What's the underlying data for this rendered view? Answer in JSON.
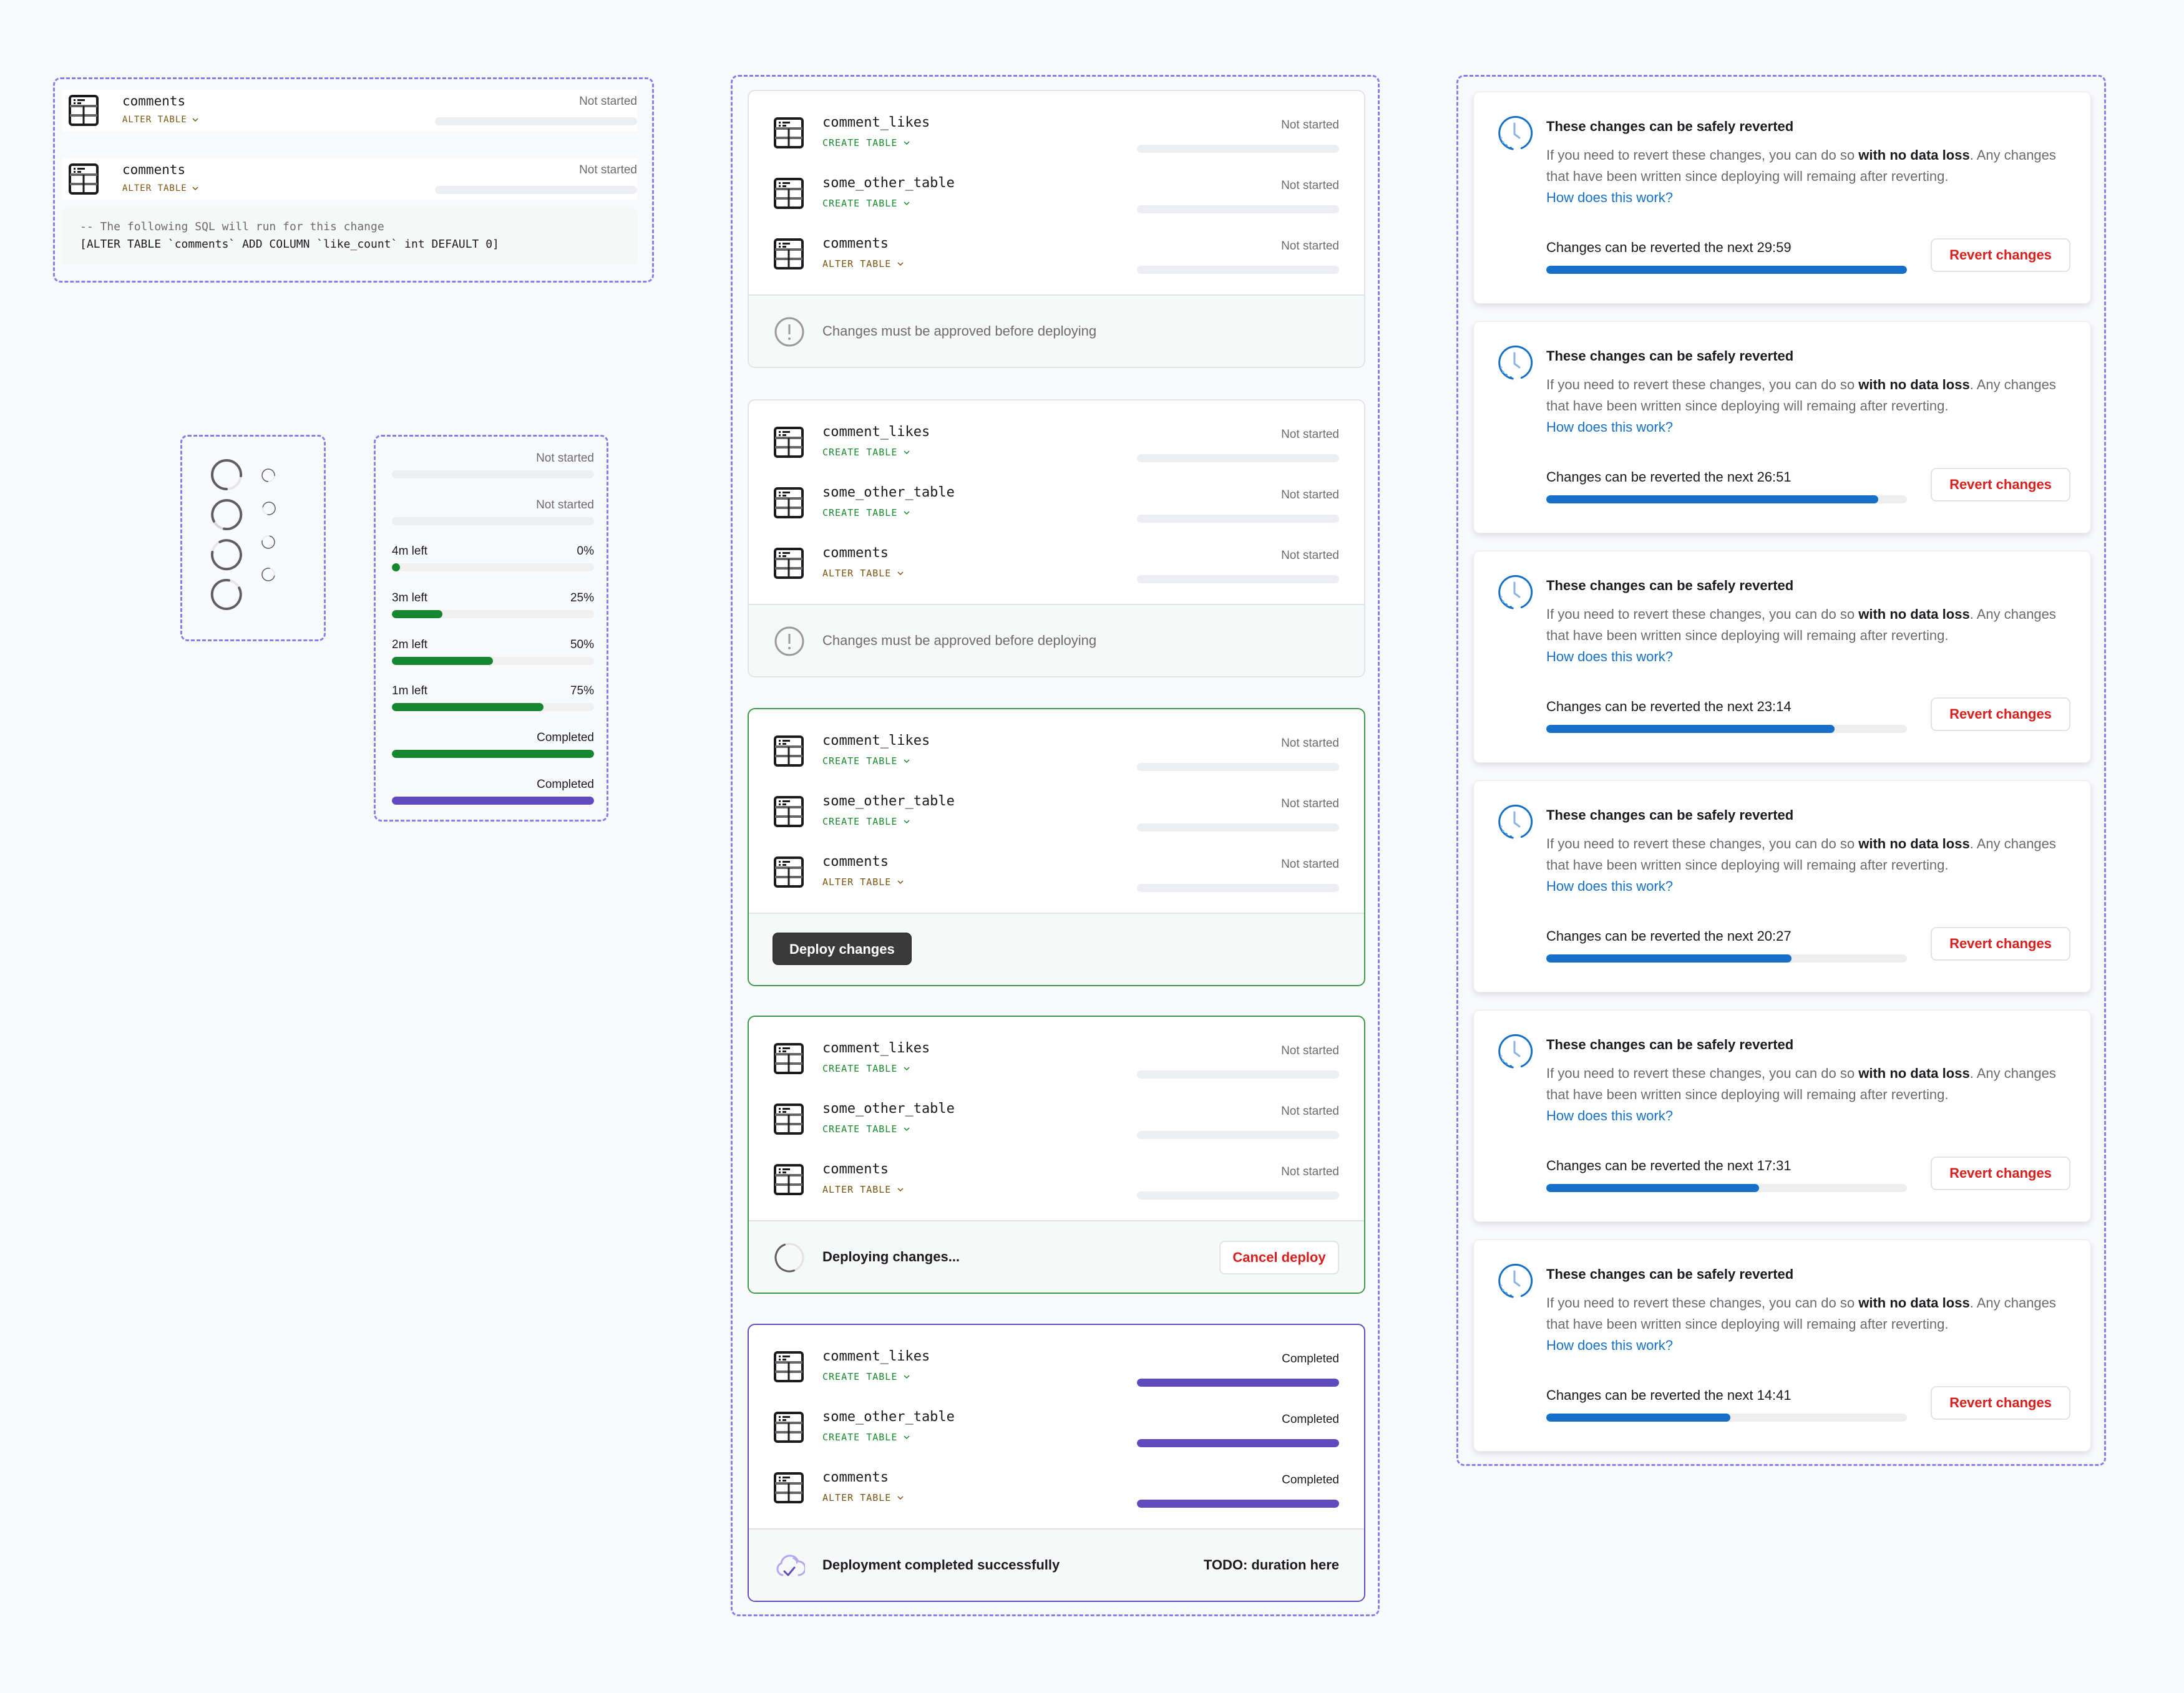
{
  "colors": {
    "frame_border": "#8b7cf0",
    "create_table": "#1a8a2e",
    "alter_table": "#7a5410",
    "progress_green": "#16872f",
    "progress_purple": "#5f4bbd",
    "revert_blue": "#1670c9",
    "danger_red": "#d91e1e"
  },
  "sql_preview": {
    "rows": [
      {
        "name": "comments",
        "type": "ALTER TABLE",
        "status": "Not started",
        "progress": 0
      },
      {
        "name": "comments",
        "type": "ALTER TABLE",
        "status": "Not started",
        "progress": 0
      }
    ],
    "comment": "-- The following SQL will run for this change",
    "statement": "[ALTER TABLE `comments` ADD COLUMN `like_count` int DEFAULT 0]"
  },
  "spinners": {
    "large_count": 4,
    "small_count": 4
  },
  "progress_demo": [
    {
      "label": "",
      "value": "Not started",
      "progress": 0,
      "color": "grey"
    },
    {
      "label": "",
      "value": "Not started",
      "progress": 0,
      "color": "grey"
    },
    {
      "label": "4m left",
      "value": "0%",
      "progress": 0,
      "color": "green"
    },
    {
      "label": "3m left",
      "value": "25%",
      "progress": 25,
      "color": "green"
    },
    {
      "label": "2m left",
      "value": "50%",
      "progress": 50,
      "color": "green"
    },
    {
      "label": "1m left",
      "value": "75%",
      "progress": 75,
      "color": "green"
    },
    {
      "label": "",
      "value": "Completed",
      "progress": 100,
      "color": "green"
    },
    {
      "label": "",
      "value": "Completed",
      "progress": 100,
      "color": "purple"
    }
  ],
  "deploy_cards": [
    {
      "state": "needs-approval",
      "rows": [
        {
          "name": "comment_likes",
          "type": "CREATE TABLE",
          "status": "Not started",
          "progress": 0
        },
        {
          "name": "some_other_table",
          "type": "CREATE TABLE",
          "status": "Not started",
          "progress": 0
        },
        {
          "name": "comments",
          "type": "ALTER TABLE",
          "status": "Not started",
          "progress": 0
        }
      ],
      "footer_text": "Changes must be approved before deploying"
    },
    {
      "state": "needs-approval",
      "rows": [
        {
          "name": "comment_likes",
          "type": "CREATE TABLE",
          "status": "Not started",
          "progress": 0
        },
        {
          "name": "some_other_table",
          "type": "CREATE TABLE",
          "status": "Not started",
          "progress": 0
        },
        {
          "name": "comments",
          "type": "ALTER TABLE",
          "status": "Not started",
          "progress": 0
        }
      ],
      "footer_text": "Changes must be approved before deploying"
    },
    {
      "state": "ready",
      "rows": [
        {
          "name": "comment_likes",
          "type": "CREATE TABLE",
          "status": "Not started",
          "progress": 0
        },
        {
          "name": "some_other_table",
          "type": "CREATE TABLE",
          "status": "Not started",
          "progress": 0
        },
        {
          "name": "comments",
          "type": "ALTER TABLE",
          "status": "Not started",
          "progress": 0
        }
      ],
      "button_label": "Deploy changes"
    },
    {
      "state": "deploying",
      "rows": [
        {
          "name": "comment_likes",
          "type": "CREATE TABLE",
          "status": "Not started",
          "progress": 0
        },
        {
          "name": "some_other_table",
          "type": "CREATE TABLE",
          "status": "Not started",
          "progress": 0
        },
        {
          "name": "comments",
          "type": "ALTER TABLE",
          "status": "Not started",
          "progress": 0
        }
      ],
      "footer_text": "Deploying changes...",
      "button_label": "Cancel deploy"
    },
    {
      "state": "completed",
      "rows": [
        {
          "name": "comment_likes",
          "type": "CREATE TABLE",
          "status": "Completed",
          "progress": 100
        },
        {
          "name": "some_other_table",
          "type": "CREATE TABLE",
          "status": "Completed",
          "progress": 100
        },
        {
          "name": "comments",
          "type": "ALTER TABLE",
          "status": "Completed",
          "progress": 100
        }
      ],
      "footer_text": "Deployment completed successfully",
      "footer_right": "TODO: duration here"
    }
  ],
  "revert_cards": {
    "title": "These changes can be safely reverted",
    "body_pre": "If you need to revert these changes, you can do so ",
    "body_bold": "with no data loss",
    "body_post": ". Any changes that have been written since deploying will remaing after reverting.",
    "link": "How does this work?",
    "countdown_prefix": "Changes can be reverted the next ",
    "button_label": "Revert changes",
    "items": [
      {
        "time": "29:59",
        "progress": 100
      },
      {
        "time": "26:51",
        "progress": 92
      },
      {
        "time": "23:14",
        "progress": 80
      },
      {
        "time": "20:27",
        "progress": 68
      },
      {
        "time": "17:31",
        "progress": 59
      },
      {
        "time": "14:41",
        "progress": 51
      }
    ]
  }
}
